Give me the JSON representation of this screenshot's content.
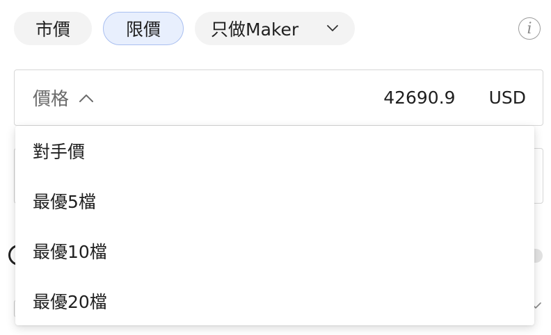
{
  "order_types": {
    "market": "市價",
    "limit": "限價",
    "maker_only": "只做Maker"
  },
  "price_field": {
    "label": "價格",
    "value": "42690.9",
    "unit": "USD"
  },
  "price_options": [
    "對手價",
    "最優5檔",
    "最優10檔",
    "最優20檔"
  ],
  "info_glyph": "i",
  "colors": {
    "active_pill_bg": "#e8effd",
    "active_pill_border": "#a9bff0",
    "pill_bg": "#f3f3f3",
    "border": "#d6d6d6"
  },
  "icons": {
    "maker_dropdown": "chevron-down-icon",
    "price_dropdown": "chevron-up-icon",
    "info": "info-icon"
  }
}
